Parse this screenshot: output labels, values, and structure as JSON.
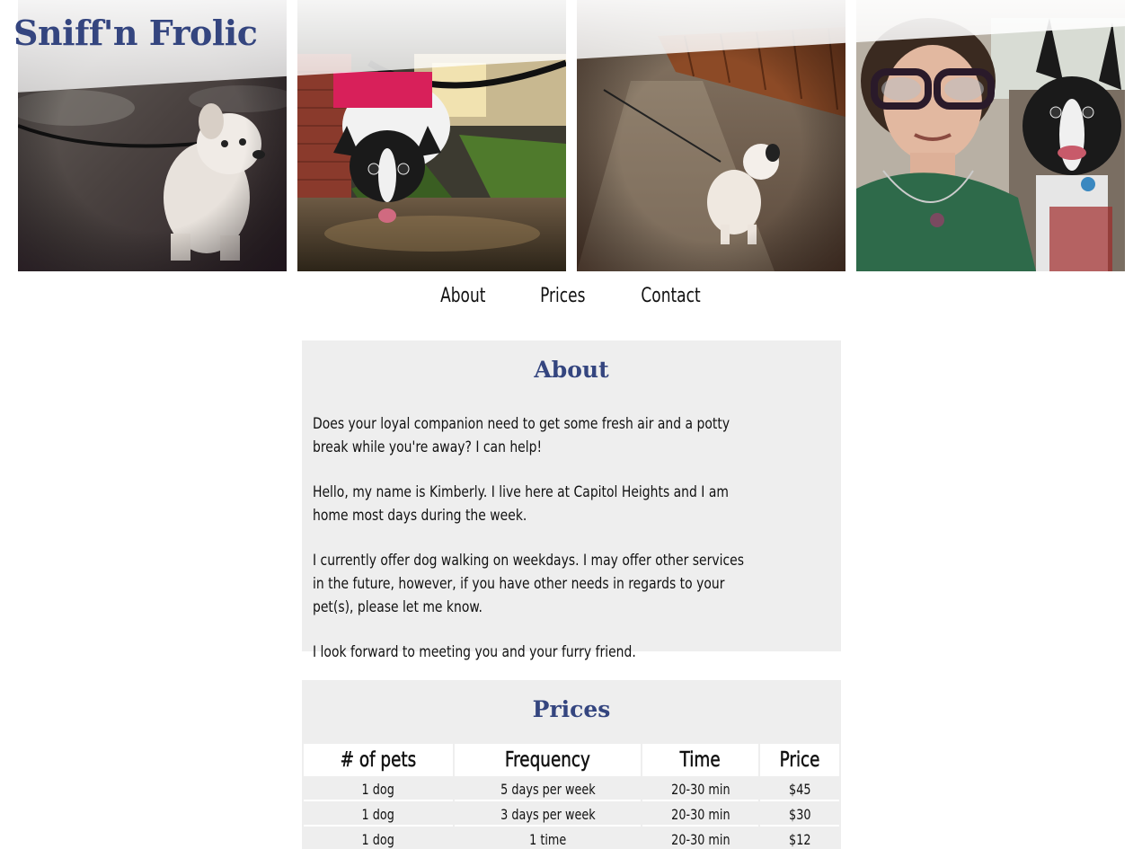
{
  "site": {
    "title": "Sniff'n Frolic",
    "brand_color": "#34457f",
    "background_color": "#ffffff",
    "card_color": "#eeeeee"
  },
  "header_photos": [
    {
      "subject": "white terrier on leash on wet pavement"
    },
    {
      "subject": "Boston terrier in red harness drinking from puddle"
    },
    {
      "subject": "small white dog sitting on wet walkway"
    },
    {
      "subject": "woman with glasses selfie with Boston terrier in car"
    }
  ],
  "nav": {
    "items": [
      "About",
      "Prices",
      "Contact"
    ]
  },
  "about": {
    "heading": "About",
    "paragraphs": [
      "Does your loyal companion need to get some fresh air and a potty break while you're away? I can help!",
      "Hello, my name is Kimberly. I live here at Capitol Heights and I am home most days during the week.",
      "I currently offer dog walking on weekdays. I may offer other services in the future, however, if you have other needs in regards to your pet(s), please let me know.",
      "I look forward to meeting you and your furry friend."
    ]
  },
  "prices": {
    "heading": "Prices",
    "columns": [
      "# of pets",
      "Frequency",
      "Time",
      "Price"
    ],
    "rows": [
      [
        "1 dog",
        "5 days per week",
        "20-30 min",
        "$45"
      ],
      [
        "1 dog",
        "3 days per week",
        "20-30 min",
        "$30"
      ],
      [
        "1 dog",
        "1 time",
        "20-30 min",
        "$12"
      ]
    ]
  }
}
